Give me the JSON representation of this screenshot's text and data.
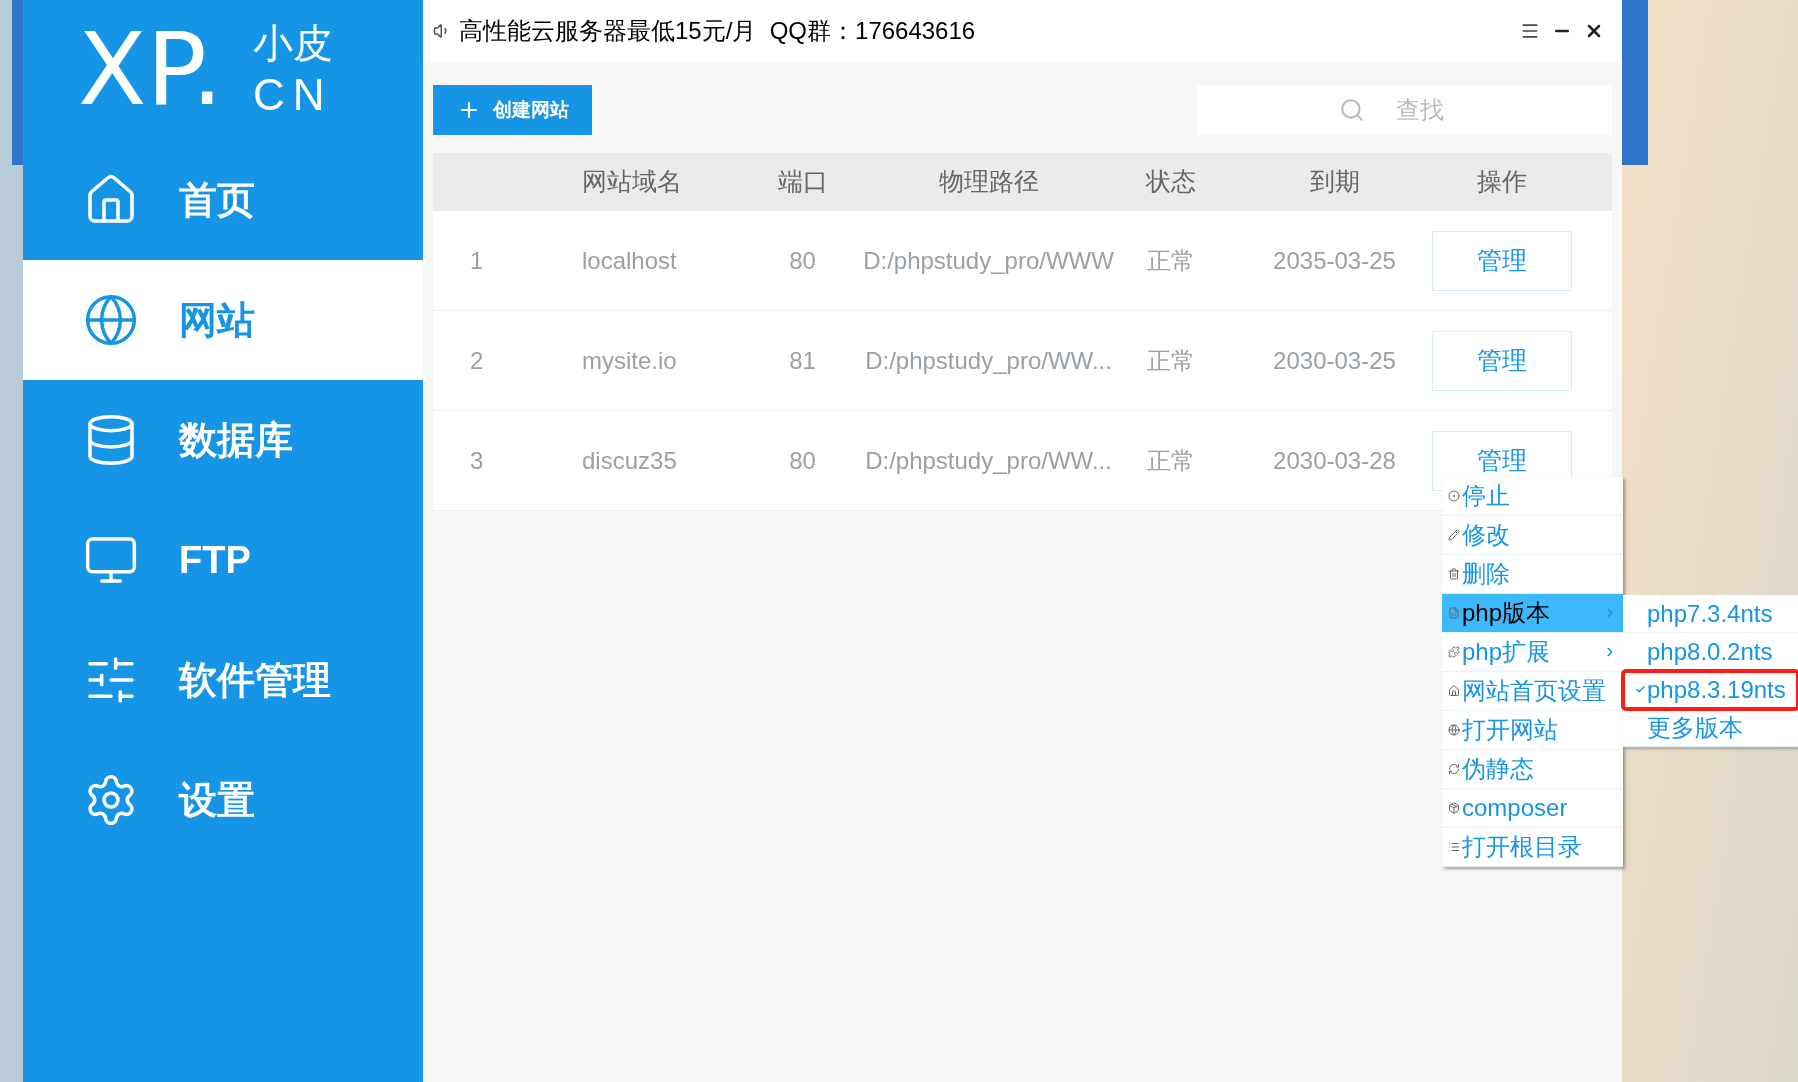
{
  "notice": "高性能云服务器最低15元/月  QQ群：176643616",
  "logo": {
    "main": "XP.",
    "top": "小皮",
    "bottom": "CN"
  },
  "sidebar": {
    "items": [
      {
        "label": "首页",
        "selected": false
      },
      {
        "label": "网站",
        "selected": true
      },
      {
        "label": "数据库",
        "selected": false
      },
      {
        "label": "FTP",
        "selected": false
      },
      {
        "label": "软件管理",
        "selected": false
      },
      {
        "label": "设置",
        "selected": false
      }
    ]
  },
  "toolbar": {
    "create_button": "创建网站",
    "search": {
      "placeholder": "查找"
    }
  },
  "table": {
    "columns": [
      "网站域名",
      "端口",
      "物理路径",
      "状态",
      "到期",
      "操作"
    ],
    "rows": [
      {
        "index": "1",
        "domain": "localhost",
        "port": "80",
        "path": "D:/phpstudy_pro/WWW",
        "status": "正常",
        "expires": "2035-03-25",
        "action": "管理"
      },
      {
        "index": "2",
        "domain": "mysite.io",
        "port": "81",
        "path": "D:/phpstudy_pro/WW...",
        "status": "正常",
        "expires": "2030-03-25",
        "action": "管理"
      },
      {
        "index": "3",
        "domain": "discuz35",
        "port": "80",
        "path": "D:/phpstudy_pro/WW...",
        "status": "正常",
        "expires": "2030-03-28",
        "action": "管理"
      }
    ]
  },
  "context_menu": {
    "items": [
      {
        "label": "停止",
        "highlighted": false,
        "has_submenu": false
      },
      {
        "label": "修改",
        "highlighted": false,
        "has_submenu": false
      },
      {
        "label": "删除",
        "highlighted": false,
        "has_submenu": false
      },
      {
        "label": "php版本",
        "highlighted": true,
        "has_submenu": true
      },
      {
        "label": "php扩展",
        "highlighted": false,
        "has_submenu": true
      },
      {
        "label": "网站首页设置",
        "highlighted": false,
        "has_submenu": false
      },
      {
        "label": "打开网站",
        "highlighted": false,
        "has_submenu": false
      },
      {
        "label": "伪静态",
        "highlighted": false,
        "has_submenu": false
      },
      {
        "label": "composer",
        "highlighted": false,
        "has_submenu": false
      },
      {
        "label": "打开根目录",
        "highlighted": false,
        "has_submenu": false
      }
    ]
  },
  "submenu": {
    "items": [
      {
        "label": "php7.3.4nts",
        "checked": false,
        "outlined": false
      },
      {
        "label": "php8.0.2nts",
        "checked": false,
        "outlined": false
      },
      {
        "label": "php8.3.19nts",
        "checked": true,
        "outlined": true
      },
      {
        "label": "更多版本",
        "checked": false,
        "outlined": false
      }
    ]
  }
}
